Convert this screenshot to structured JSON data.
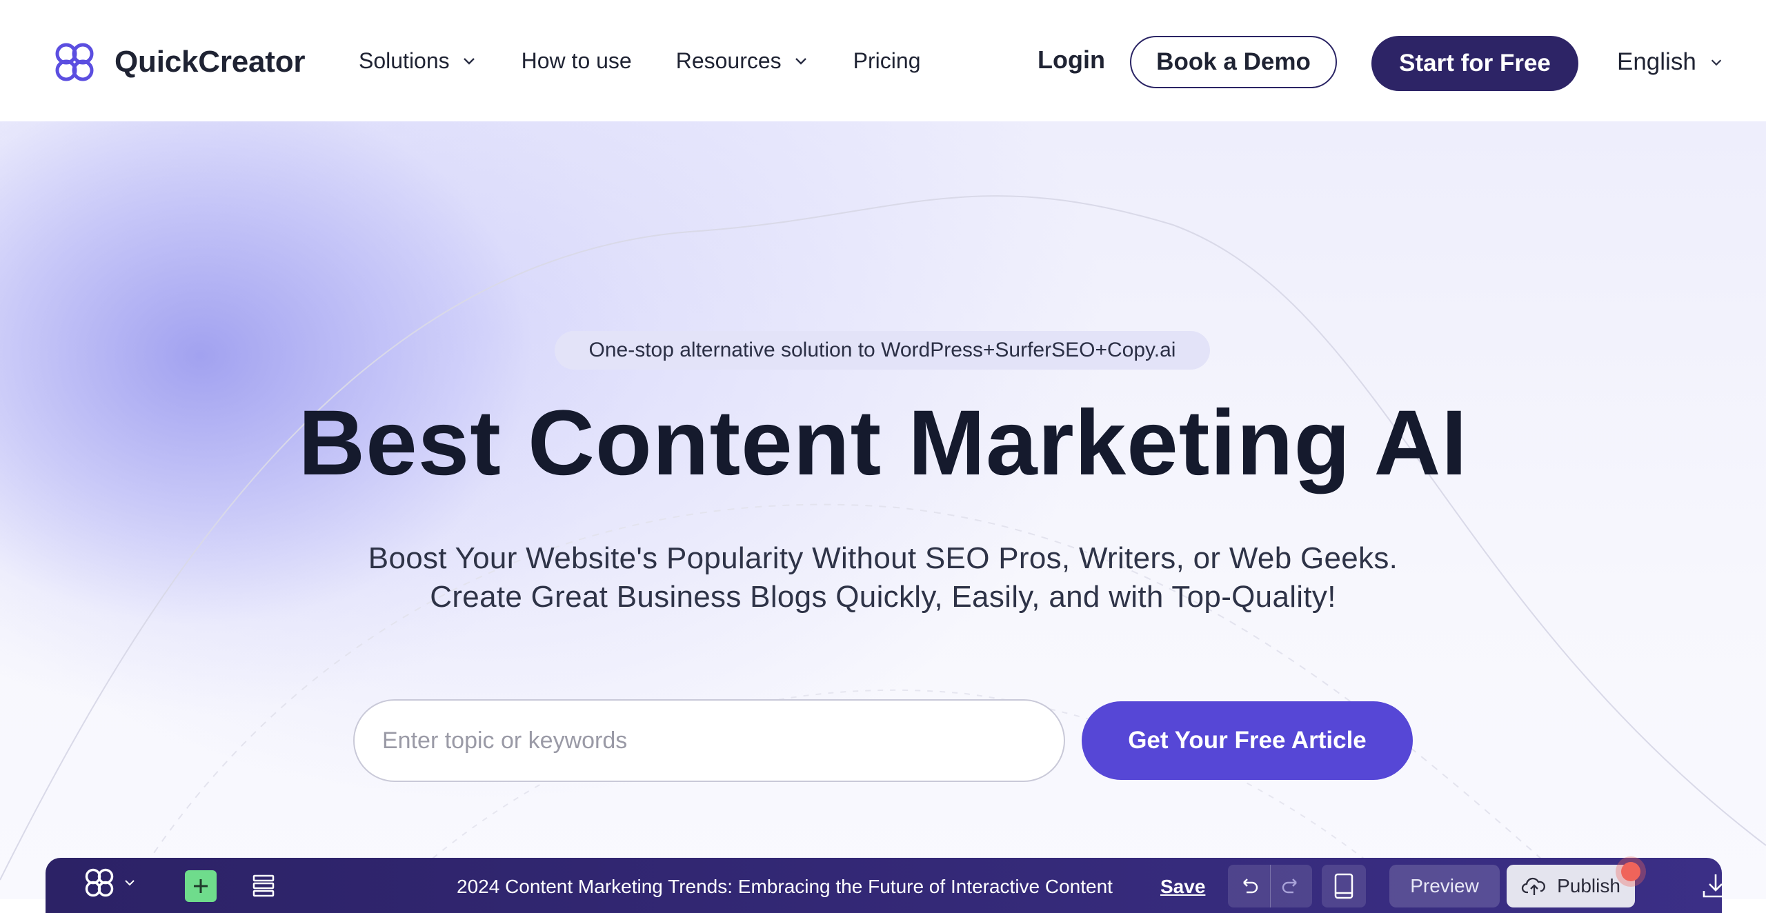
{
  "header": {
    "logo_text": "QuickCreator",
    "nav": [
      {
        "label": "Solutions",
        "has_dropdown": true
      },
      {
        "label": "How to use",
        "has_dropdown": false
      },
      {
        "label": "Resources",
        "has_dropdown": true
      },
      {
        "label": "Pricing",
        "has_dropdown": false
      }
    ],
    "login_label": "Login",
    "demo_label": "Book a Demo",
    "start_label": "Start for Free",
    "language": "English"
  },
  "hero": {
    "pill_text": "One-stop alternative solution to WordPress+SurferSEO+Copy.ai",
    "title": "Best Content Marketing AI",
    "subtitle_line1": "Boost Your Website's Popularity Without SEO Pros, Writers, or Web Geeks.",
    "subtitle_line2": "Create Great Business Blogs Quickly, Easily, and with Top-Quality!",
    "search_placeholder": "Enter topic or keywords",
    "cta_label": "Get Your Free Article"
  },
  "editor": {
    "article_title": "2024 Content Marketing Trends: Embracing the Future of Interactive Content",
    "save_label": "Save",
    "preview_label": "Preview",
    "publish_label": "Publish"
  },
  "colors": {
    "brand_dark": "#2d2466",
    "cta_purple": "#5647d6",
    "logo_purple": "#5b4ee0",
    "editor_plus_green": "#6fdc8c"
  },
  "icons": [
    "logo-icon",
    "chevron-down-icon",
    "plus-icon",
    "list-icon",
    "undo-icon",
    "redo-icon",
    "device-icon",
    "cloud-upload-icon",
    "download-icon"
  ]
}
